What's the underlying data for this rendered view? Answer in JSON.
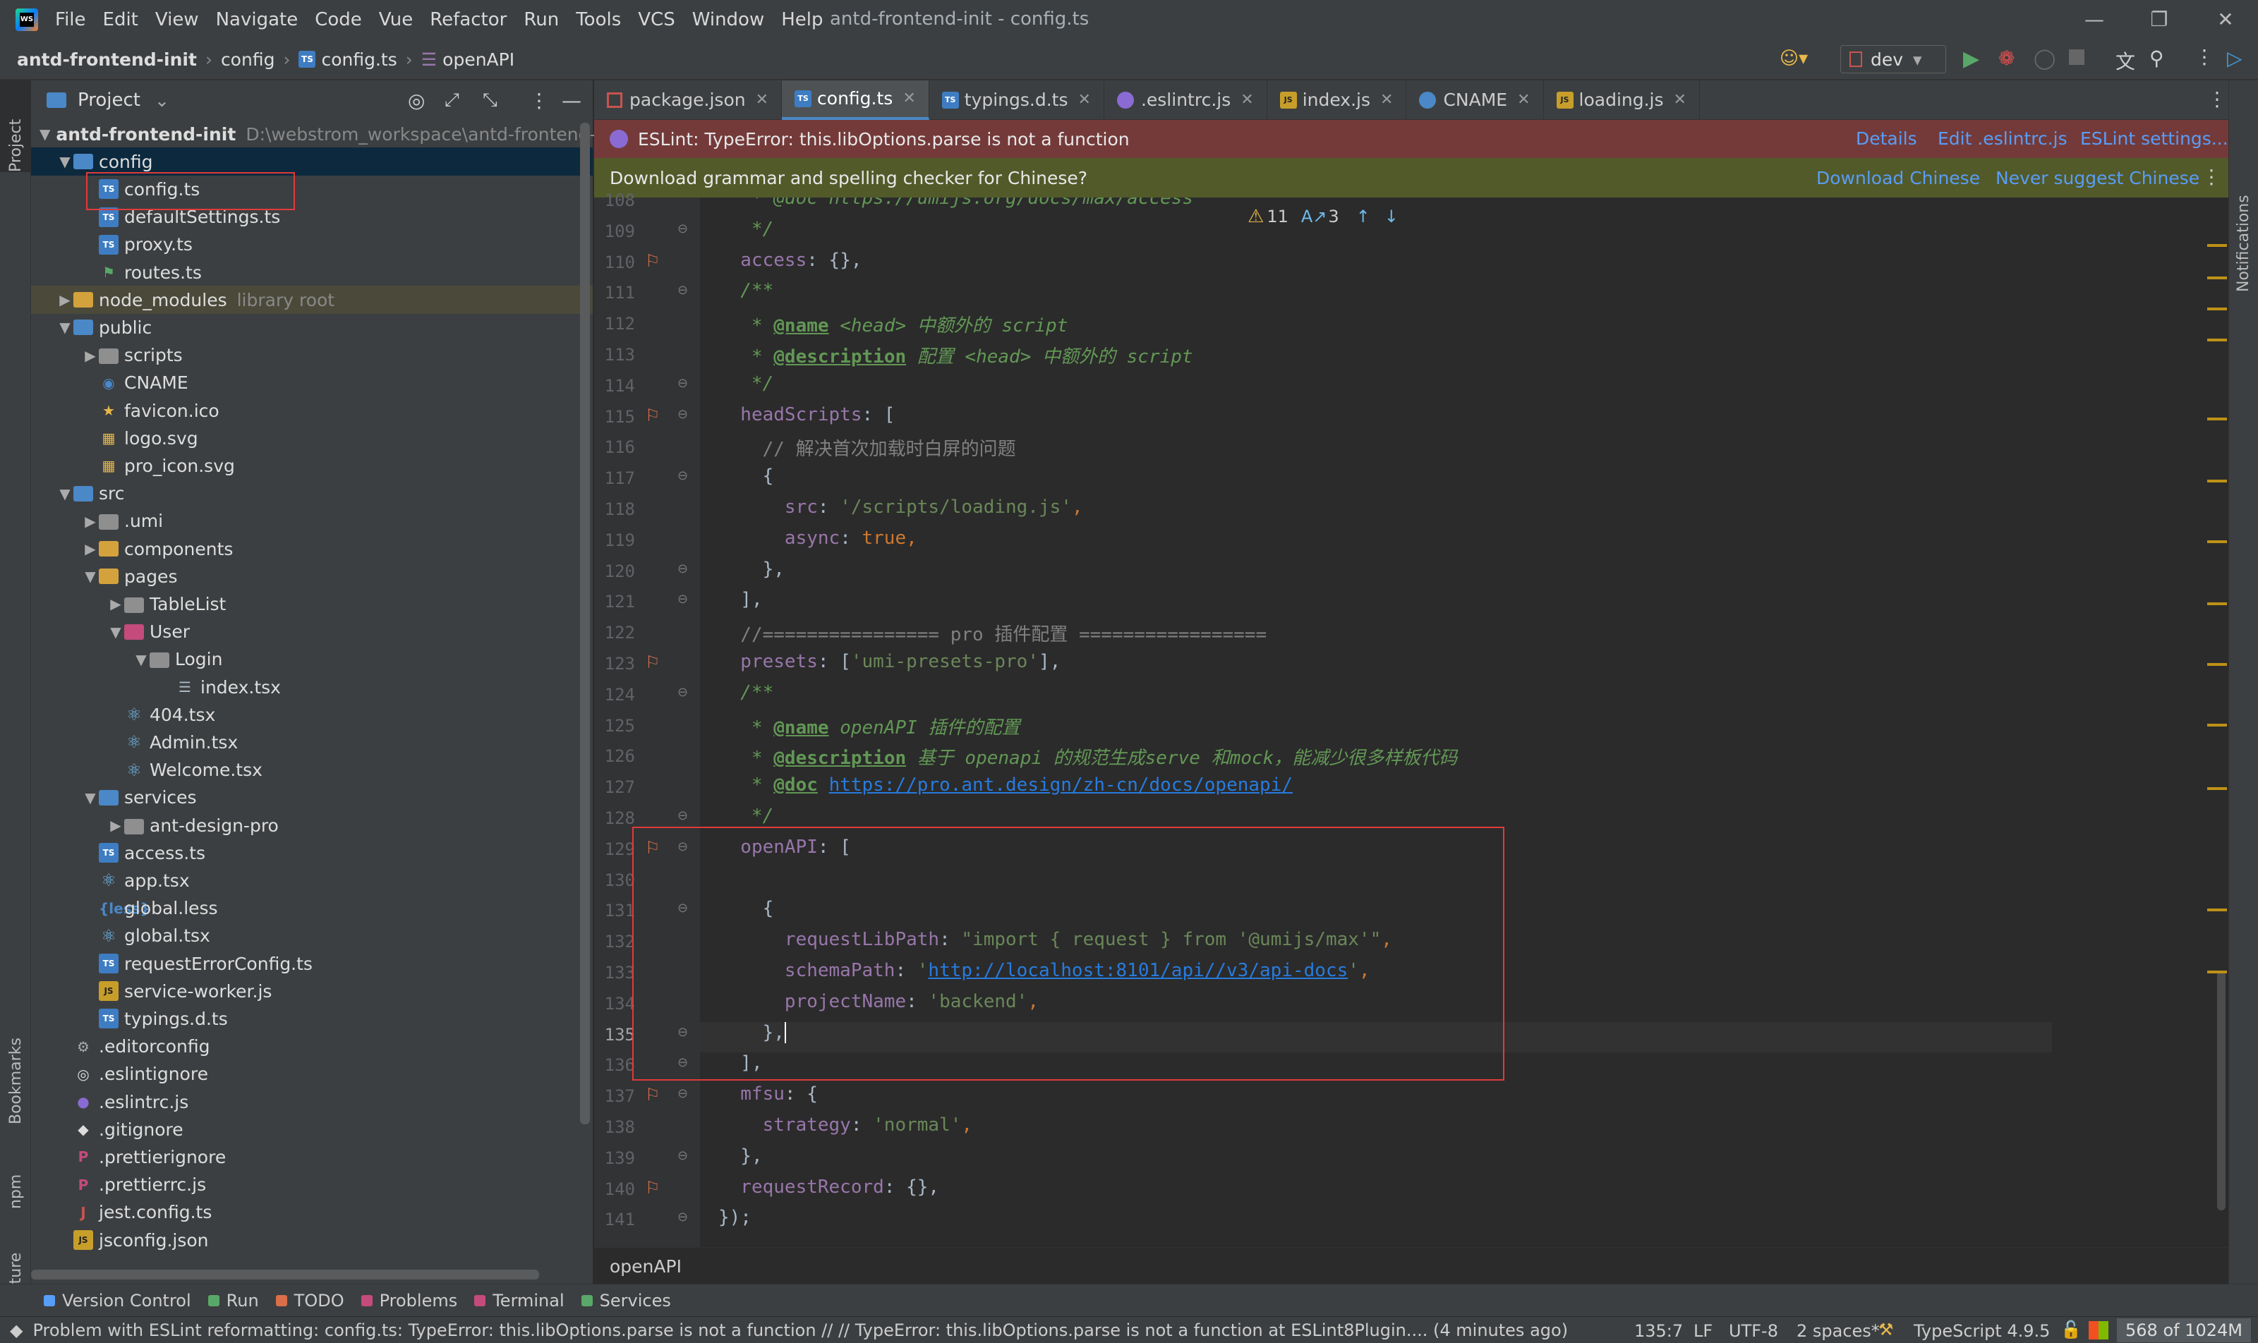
{
  "menu": [
    "File",
    "Edit",
    "View",
    "Navigate",
    "Code",
    "Vue",
    "Refactor",
    "Run",
    "Tools",
    "VCS",
    "Window",
    "Help"
  ],
  "window_title": "antd-frontend-init - config.ts",
  "nav": {
    "project": "antd-frontend-init",
    "folder": "config",
    "file": "config.ts",
    "symbol": "openAPI",
    "run_config": "dev"
  },
  "project_panel": {
    "title": "Project",
    "root": "antd-frontend-init",
    "root_path": "D:\\webstrom_workspace\\antd-frontend-ir",
    "library_root": "library root"
  },
  "tree": [
    "config",
    "config.ts",
    "defaultSettings.ts",
    "proxy.ts",
    "routes.ts",
    "node_modules",
    "public",
    "scripts",
    "CNAME",
    "favicon.ico",
    "logo.svg",
    "pro_icon.svg",
    "src",
    ".umi",
    "components",
    "pages",
    "TableList",
    "User",
    "Login",
    "index.tsx",
    "404.tsx",
    "Admin.tsx",
    "Welcome.tsx",
    "services",
    "ant-design-pro",
    "access.ts",
    "app.tsx",
    "global.less",
    "global.tsx",
    "requestErrorConfig.ts",
    "service-worker.js",
    "typings.d.ts",
    ".editorconfig",
    ".eslintignore",
    ".eslintrc.js",
    ".gitignore",
    ".prettierignore",
    ".prettierrc.js",
    "jest.config.ts",
    "jsconfig.json"
  ],
  "tabs": [
    "package.json",
    "config.ts",
    "typings.d.ts",
    ".eslintrc.js",
    "index.js",
    "CNAME",
    "loading.js"
  ],
  "error_bar": {
    "message": "ESLint: TypeError: this.libOptions.parse is not a function",
    "details": "Details",
    "edit": "Edit .eslintrc.js",
    "settings": "ESLint settings..."
  },
  "spell_bar": {
    "message": "Download grammar and spelling checker for Chinese?",
    "download": "Download Chinese",
    "never": "Never suggest Chinese"
  },
  "inspections": {
    "warnings": "11",
    "typos": "3"
  },
  "line_numbers": [
    "108",
    "109",
    "110",
    "111",
    "112",
    "113",
    "114",
    "115",
    "116",
    "117",
    "118",
    "119",
    "120",
    "121",
    "122",
    "123",
    "124",
    "125",
    "126",
    "127",
    "128",
    "129",
    "130",
    "131",
    "132",
    "133",
    "134",
    "135",
    "136",
    "137",
    "138",
    "139",
    "140",
    "141"
  ],
  "code": {
    "l108": "   * @doc https://umijs.org/docs/max/access",
    "l109": "   */",
    "l110a": "  access",
    "l110b": ": {},",
    "l111": "  /**",
    "l112a": "   * ",
    "l112b": "@name",
    "l112c": " <head> 中额外的 script",
    "l113a": "   * ",
    "l113b": "@description",
    "l113c": " 配置 <head> 中额外的 script",
    "l114": "   */",
    "l115a": "  headScripts",
    "l115b": ": [",
    "l116": "    // 解决首次加载时白屏的问题",
    "l117": "    {",
    "l118a": "      src",
    "l118b": ": ",
    "l118c": "'/scripts/loading.js'",
    "l118d": ",",
    "l119a": "      async",
    "l119b": ": ",
    "l119c": "true",
    "l119d": ",",
    "l120": "    },",
    "l121": "  ],",
    "l122": "  //================ pro 插件配置 =================",
    "l123a": "  presets",
    "l123b": ": [",
    "l123c": "'umi-presets-pro'",
    "l123d": "],",
    "l124": "  /**",
    "l125a": "   * ",
    "l125b": "@name",
    "l125c": " openAPI 插件的配置",
    "l126a": "   * ",
    "l126b": "@description",
    "l126c": " 基于 openapi 的规范生成serve 和mock，能减少很多样板代码",
    "l127a": "   * ",
    "l127b": "@doc",
    "l127c": " ",
    "l127d": "https://pro.ant.design/zh-cn/docs/openapi/",
    "l128": "   */",
    "l129a": "  openAPI",
    "l129b": ": [",
    "l131": "    {",
    "l132a": "      requestLibPath",
    "l132b": ": ",
    "l132c": "\"import { request } from '@umijs/max'\"",
    "l132d": ",",
    "l133a": "      schemaPath",
    "l133b": ": ",
    "l133c": "'",
    "l133d": "http://localhost:8101/api//v3/api-docs",
    "l133e": "'",
    ",l133f": "",
    "l134a": "      projectName",
    "l134b": ": ",
    "l134c": "'backend'",
    "l134d": ",",
    "l135": "    },",
    "l136": "  ],",
    "l137a": "  mfsu",
    "l137b": ": {",
    "l138a": "    strategy",
    "l138b": ": ",
    "l138c": "'normal'",
    "l138d": ",",
    "l139": "  },",
    "l140a": "  requestRecord",
    "l140b": ": {},",
    "l141": "});"
  },
  "bottom_breadcrumb": "openAPI",
  "toolwindows": [
    "Version Control",
    "Run",
    "TODO",
    "Problems",
    "Terminal",
    "Services"
  ],
  "side_labels": {
    "project": "Project",
    "bookmarks": "Bookmarks",
    "npm": "npm",
    "structure": "Structure",
    "notifications": "Notifications"
  },
  "status": {
    "message": "Problem with ESLint reformatting: config.ts: TypeError: this.libOptions.parse is not a function // // TypeError: this.libOptions.parse is not a function    at ESLint8Plugin.... (4 minutes ago)",
    "position": "135:7",
    "line_sep": "LF",
    "encoding": "UTF-8",
    "indent": "2 spaces*",
    "lang": "TypeScript 4.9.5",
    "memory": "568 of 1024M"
  }
}
